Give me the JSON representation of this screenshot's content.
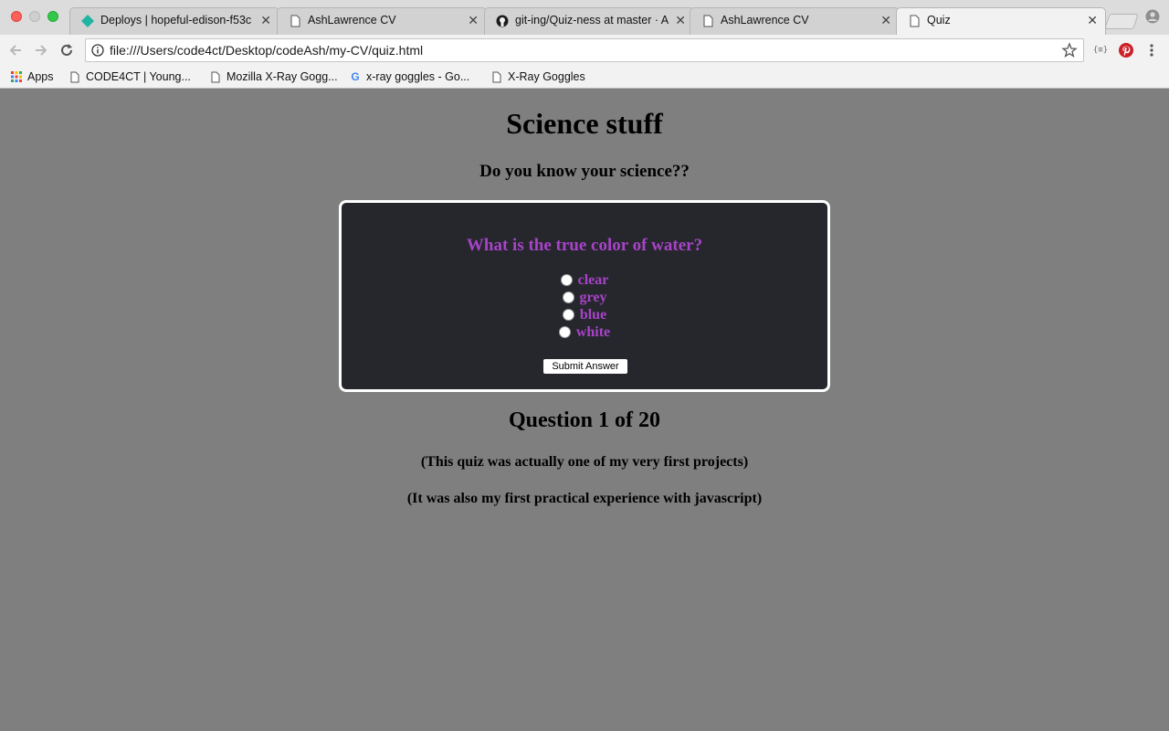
{
  "browser": {
    "tabs": [
      {
        "title": "Deploys | hopeful-edison-f53c",
        "icon": "netlify-icon"
      },
      {
        "title": "AshLawrence CV",
        "icon": "page-icon"
      },
      {
        "title": "git-ing/Quiz-ness at master · A",
        "icon": "github-icon"
      },
      {
        "title": "AshLawrence CV",
        "icon": "page-icon"
      },
      {
        "title": "Quiz",
        "icon": "page-icon",
        "active": true
      }
    ],
    "url": "file:///Users/code4ct/Desktop/codeAsh/my-CV/quiz.html",
    "bookmarks": [
      {
        "label": "Apps",
        "icon": "apps-grid-icon"
      },
      {
        "label": "CODE4CT | Young...",
        "icon": "page-icon"
      },
      {
        "label": "Mozilla X-Ray Gogg...",
        "icon": "page-icon"
      },
      {
        "label": "x-ray goggles - Go...",
        "icon": "google-icon"
      },
      {
        "label": "X-Ray Goggles",
        "icon": "page-icon"
      }
    ],
    "extensions": [
      {
        "label": "{≡}",
        "icon": "json-viewer-icon"
      },
      {
        "label": "",
        "icon": "pinterest-icon"
      }
    ]
  },
  "page": {
    "title": "Science stuff",
    "subtitle": "Do you know your science??",
    "quiz": {
      "question": "What is the true color of water?",
      "answers": [
        "clear",
        "grey",
        "blue",
        "white"
      ],
      "submit_label": "Submit Answer"
    },
    "progress": "Question 1 of 20",
    "notes": [
      "(This quiz was actually one of my very first projects)",
      "(It was also my first practical experience with javascript)"
    ]
  },
  "colors": {
    "page_bg": "#7f7f7f",
    "quiz_bg": "#25272d",
    "quiz_text": "#a843c8"
  }
}
